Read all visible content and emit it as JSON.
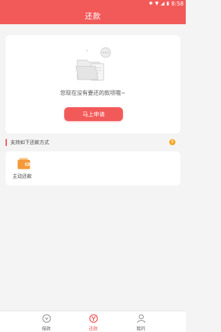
{
  "status_bar": {
    "time": "8:58"
  },
  "app_bar": {
    "title": "还款"
  },
  "empty_state": {
    "message": "您现在没有要还的款项哦~",
    "apply_label": "马上申请"
  },
  "section": {
    "title": "支持如下还款方式",
    "help_glyph": "?"
  },
  "methods": [
    {
      "label": "主动还款",
      "icon": "wallet-icon"
    }
  ],
  "tabs": [
    {
      "label": "借款",
      "icon": "loan-icon",
      "active": false
    },
    {
      "label": "还款",
      "icon": "repay-icon",
      "active": true
    },
    {
      "label": "我的",
      "icon": "profile-icon",
      "active": false
    }
  ],
  "colors": {
    "accent": "#f25a5a",
    "help": "#f5a623",
    "wallet": "#f59a3a"
  }
}
